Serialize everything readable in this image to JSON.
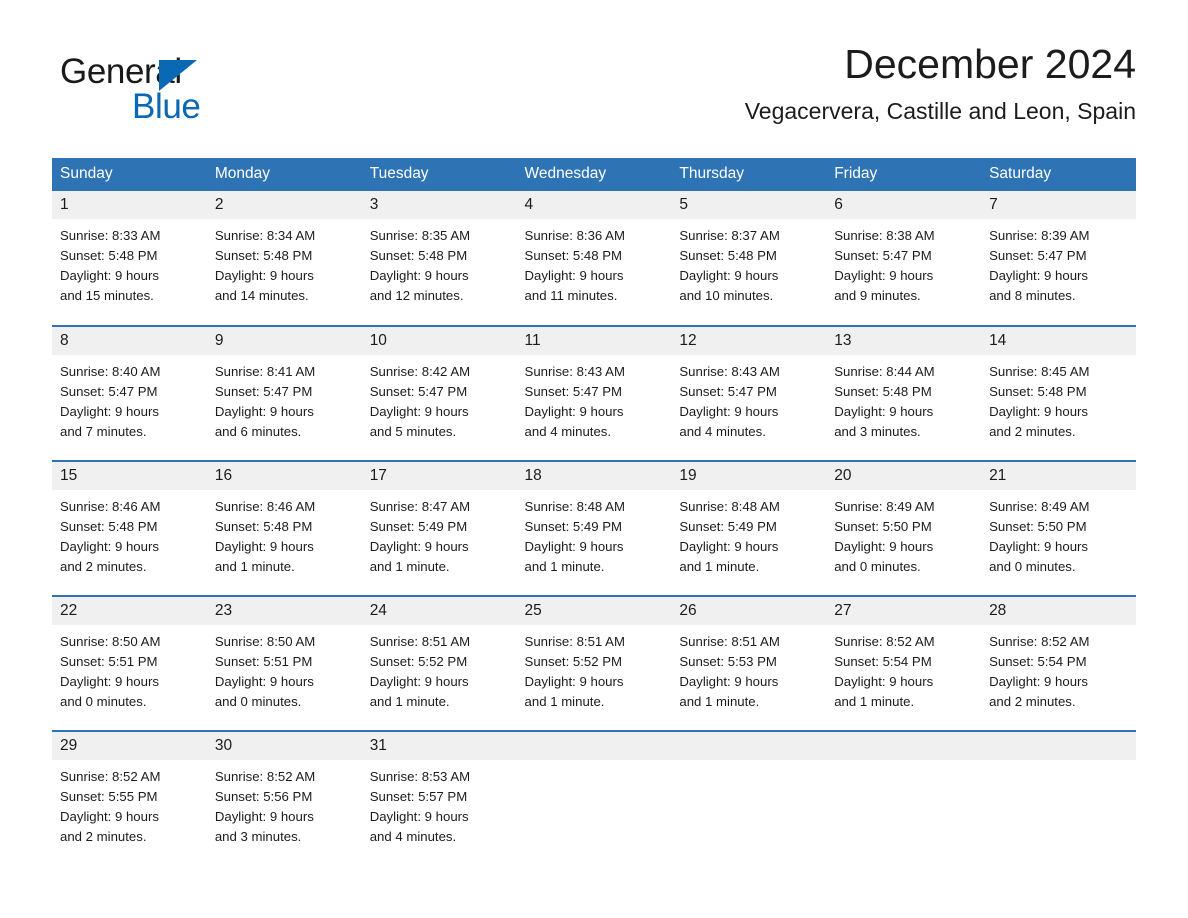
{
  "brand": {
    "line1": "General",
    "line2": "Blue",
    "triangle_color": "#0a69b4"
  },
  "header": {
    "title": "December 2024",
    "subtitle": "Vegacervera, Castille and Leon, Spain",
    "header_bg": "#2e74b5",
    "daynum_bg": "#f0f0f0"
  },
  "weekdays": [
    "Sunday",
    "Monday",
    "Tuesday",
    "Wednesday",
    "Thursday",
    "Friday",
    "Saturday"
  ],
  "weeks": [
    [
      {
        "day": "1",
        "sunrise": "Sunrise: 8:33 AM",
        "sunset": "Sunset: 5:48 PM",
        "daylight1": "Daylight: 9 hours",
        "daylight2": "and 15 minutes."
      },
      {
        "day": "2",
        "sunrise": "Sunrise: 8:34 AM",
        "sunset": "Sunset: 5:48 PM",
        "daylight1": "Daylight: 9 hours",
        "daylight2": "and 14 minutes."
      },
      {
        "day": "3",
        "sunrise": "Sunrise: 8:35 AM",
        "sunset": "Sunset: 5:48 PM",
        "daylight1": "Daylight: 9 hours",
        "daylight2": "and 12 minutes."
      },
      {
        "day": "4",
        "sunrise": "Sunrise: 8:36 AM",
        "sunset": "Sunset: 5:48 PM",
        "daylight1": "Daylight: 9 hours",
        "daylight2": "and 11 minutes."
      },
      {
        "day": "5",
        "sunrise": "Sunrise: 8:37 AM",
        "sunset": "Sunset: 5:48 PM",
        "daylight1": "Daylight: 9 hours",
        "daylight2": "and 10 minutes."
      },
      {
        "day": "6",
        "sunrise": "Sunrise: 8:38 AM",
        "sunset": "Sunset: 5:47 PM",
        "daylight1": "Daylight: 9 hours",
        "daylight2": "and 9 minutes."
      },
      {
        "day": "7",
        "sunrise": "Sunrise: 8:39 AM",
        "sunset": "Sunset: 5:47 PM",
        "daylight1": "Daylight: 9 hours",
        "daylight2": "and 8 minutes."
      }
    ],
    [
      {
        "day": "8",
        "sunrise": "Sunrise: 8:40 AM",
        "sunset": "Sunset: 5:47 PM",
        "daylight1": "Daylight: 9 hours",
        "daylight2": "and 7 minutes."
      },
      {
        "day": "9",
        "sunrise": "Sunrise: 8:41 AM",
        "sunset": "Sunset: 5:47 PM",
        "daylight1": "Daylight: 9 hours",
        "daylight2": "and 6 minutes."
      },
      {
        "day": "10",
        "sunrise": "Sunrise: 8:42 AM",
        "sunset": "Sunset: 5:47 PM",
        "daylight1": "Daylight: 9 hours",
        "daylight2": "and 5 minutes."
      },
      {
        "day": "11",
        "sunrise": "Sunrise: 8:43 AM",
        "sunset": "Sunset: 5:47 PM",
        "daylight1": "Daylight: 9 hours",
        "daylight2": "and 4 minutes."
      },
      {
        "day": "12",
        "sunrise": "Sunrise: 8:43 AM",
        "sunset": "Sunset: 5:47 PM",
        "daylight1": "Daylight: 9 hours",
        "daylight2": "and 4 minutes."
      },
      {
        "day": "13",
        "sunrise": "Sunrise: 8:44 AM",
        "sunset": "Sunset: 5:48 PM",
        "daylight1": "Daylight: 9 hours",
        "daylight2": "and 3 minutes."
      },
      {
        "day": "14",
        "sunrise": "Sunrise: 8:45 AM",
        "sunset": "Sunset: 5:48 PM",
        "daylight1": "Daylight: 9 hours",
        "daylight2": "and 2 minutes."
      }
    ],
    [
      {
        "day": "15",
        "sunrise": "Sunrise: 8:46 AM",
        "sunset": "Sunset: 5:48 PM",
        "daylight1": "Daylight: 9 hours",
        "daylight2": "and 2 minutes."
      },
      {
        "day": "16",
        "sunrise": "Sunrise: 8:46 AM",
        "sunset": "Sunset: 5:48 PM",
        "daylight1": "Daylight: 9 hours",
        "daylight2": "and 1 minute."
      },
      {
        "day": "17",
        "sunrise": "Sunrise: 8:47 AM",
        "sunset": "Sunset: 5:49 PM",
        "daylight1": "Daylight: 9 hours",
        "daylight2": "and 1 minute."
      },
      {
        "day": "18",
        "sunrise": "Sunrise: 8:48 AM",
        "sunset": "Sunset: 5:49 PM",
        "daylight1": "Daylight: 9 hours",
        "daylight2": "and 1 minute."
      },
      {
        "day": "19",
        "sunrise": "Sunrise: 8:48 AM",
        "sunset": "Sunset: 5:49 PM",
        "daylight1": "Daylight: 9 hours",
        "daylight2": "and 1 minute."
      },
      {
        "day": "20",
        "sunrise": "Sunrise: 8:49 AM",
        "sunset": "Sunset: 5:50 PM",
        "daylight1": "Daylight: 9 hours",
        "daylight2": "and 0 minutes."
      },
      {
        "day": "21",
        "sunrise": "Sunrise: 8:49 AM",
        "sunset": "Sunset: 5:50 PM",
        "daylight1": "Daylight: 9 hours",
        "daylight2": "and 0 minutes."
      }
    ],
    [
      {
        "day": "22",
        "sunrise": "Sunrise: 8:50 AM",
        "sunset": "Sunset: 5:51 PM",
        "daylight1": "Daylight: 9 hours",
        "daylight2": "and 0 minutes."
      },
      {
        "day": "23",
        "sunrise": "Sunrise: 8:50 AM",
        "sunset": "Sunset: 5:51 PM",
        "daylight1": "Daylight: 9 hours",
        "daylight2": "and 0 minutes."
      },
      {
        "day": "24",
        "sunrise": "Sunrise: 8:51 AM",
        "sunset": "Sunset: 5:52 PM",
        "daylight1": "Daylight: 9 hours",
        "daylight2": "and 1 minute."
      },
      {
        "day": "25",
        "sunrise": "Sunrise: 8:51 AM",
        "sunset": "Sunset: 5:52 PM",
        "daylight1": "Daylight: 9 hours",
        "daylight2": "and 1 minute."
      },
      {
        "day": "26",
        "sunrise": "Sunrise: 8:51 AM",
        "sunset": "Sunset: 5:53 PM",
        "daylight1": "Daylight: 9 hours",
        "daylight2": "and 1 minute."
      },
      {
        "day": "27",
        "sunrise": "Sunrise: 8:52 AM",
        "sunset": "Sunset: 5:54 PM",
        "daylight1": "Daylight: 9 hours",
        "daylight2": "and 1 minute."
      },
      {
        "day": "28",
        "sunrise": "Sunrise: 8:52 AM",
        "sunset": "Sunset: 5:54 PM",
        "daylight1": "Daylight: 9 hours",
        "daylight2": "and 2 minutes."
      }
    ],
    [
      {
        "day": "29",
        "sunrise": "Sunrise: 8:52 AM",
        "sunset": "Sunset: 5:55 PM",
        "daylight1": "Daylight: 9 hours",
        "daylight2": "and 2 minutes."
      },
      {
        "day": "30",
        "sunrise": "Sunrise: 8:52 AM",
        "sunset": "Sunset: 5:56 PM",
        "daylight1": "Daylight: 9 hours",
        "daylight2": "and 3 minutes."
      },
      {
        "day": "31",
        "sunrise": "Sunrise: 8:53 AM",
        "sunset": "Sunset: 5:57 PM",
        "daylight1": "Daylight: 9 hours",
        "daylight2": "and 4 minutes."
      },
      {
        "day": "",
        "sunrise": "",
        "sunset": "",
        "daylight1": "",
        "daylight2": ""
      },
      {
        "day": "",
        "sunrise": "",
        "sunset": "",
        "daylight1": "",
        "daylight2": ""
      },
      {
        "day": "",
        "sunrise": "",
        "sunset": "",
        "daylight1": "",
        "daylight2": ""
      },
      {
        "day": "",
        "sunrise": "",
        "sunset": "",
        "daylight1": "",
        "daylight2": ""
      }
    ]
  ]
}
